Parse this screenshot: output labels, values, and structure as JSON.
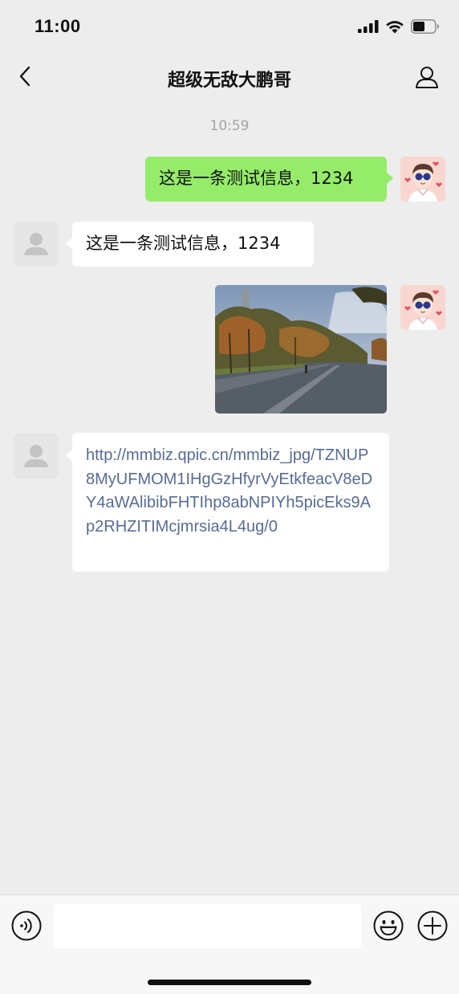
{
  "status_bar": {
    "time": "11:00",
    "icons": [
      "signal-icon",
      "wifi-icon",
      "battery-icon"
    ]
  },
  "header": {
    "title": "超级无敌大鹏哥",
    "back_icon": "chevron-left-icon",
    "profile_icon": "person-icon"
  },
  "chat": {
    "timestamp": "10:59",
    "messages": [
      {
        "sender": "self",
        "type": "text",
        "text": "这是一条测试信息，1234"
      },
      {
        "sender": "other",
        "type": "text",
        "text": "这是一条测试信息，1234"
      },
      {
        "sender": "self",
        "type": "image"
      },
      {
        "sender": "other",
        "type": "link",
        "text": "http://mmbiz.qpic.cn/mmbiz_jpg/TZNUP8MyUFMOM1IHgGzHfyrVyEtkfeacV8eDY4aWAlibibFHTIhp8abNPIYh5picEks9Ap2RHZITIMcjmrsia4L4ug/0"
      }
    ]
  },
  "input_bar": {
    "placeholder": "",
    "icons": [
      "voice-icon",
      "emoji-icon",
      "plus-icon"
    ]
  },
  "colors": {
    "background": "#ededed",
    "self_bubble": "#95ec69",
    "other_bubble": "#ffffff",
    "link": "#576b95",
    "timestamp": "#a5a5a5"
  }
}
